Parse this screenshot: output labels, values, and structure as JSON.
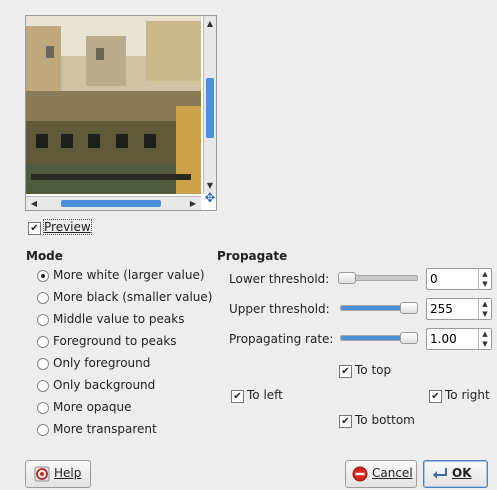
{
  "preview": {
    "label": "Preview",
    "checked": true
  },
  "mode": {
    "title": "Mode",
    "options": [
      {
        "label": "More white (larger value)",
        "checked": true
      },
      {
        "label": "More black (smaller value)",
        "checked": false
      },
      {
        "label": "Middle value to peaks",
        "checked": false
      },
      {
        "label": "Foreground to peaks",
        "checked": false
      },
      {
        "label": "Only foreground",
        "checked": false
      },
      {
        "label": "Only background",
        "checked": false
      },
      {
        "label": "More opaque",
        "checked": false
      },
      {
        "label": "More transparent",
        "checked": false
      }
    ]
  },
  "propagate": {
    "title": "Propagate",
    "lower_threshold": {
      "label": "Lower threshold:",
      "value": "0",
      "fraction": 0.0
    },
    "upper_threshold": {
      "label": "Upper threshold:",
      "value": "255",
      "fraction": 1.0
    },
    "propagating_rate": {
      "label": "Propagating rate:",
      "value": "1.00",
      "fraction": 1.0
    },
    "directions": {
      "to_top": {
        "label": "To top",
        "checked": true
      },
      "to_left": {
        "label": "To left",
        "checked": true
      },
      "to_right": {
        "label": "To right",
        "checked": true
      },
      "to_bottom": {
        "label": "To bottom",
        "checked": true
      }
    }
  },
  "buttons": {
    "help": "Help",
    "cancel": "Cancel",
    "ok": "OK"
  },
  "icons": {
    "check": "✔",
    "scroll_up": "▲",
    "scroll_down": "▼",
    "scroll_left": "◀",
    "scroll_right": "▶",
    "navigate": "✥"
  },
  "colors": {
    "accent": "#4a90d9"
  }
}
